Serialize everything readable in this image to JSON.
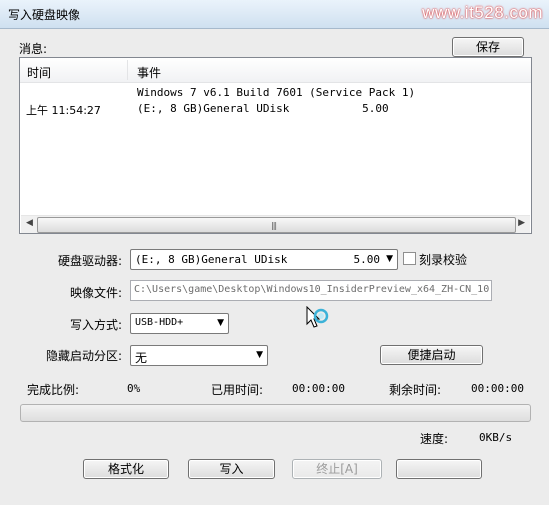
{
  "window": {
    "title": "写入硬盘映像",
    "watermark": "www.it528.com"
  },
  "messages": {
    "label": "消息:",
    "save_button": "保存",
    "columns": [
      "时间",
      "事件"
    ],
    "rows": [
      {
        "time": "",
        "event": "Windows 7 v6.1 Build 7601 (Service Pack 1)"
      },
      {
        "time": "上午 11:54:27",
        "event": "(E:, 8 GB)General UDisk           5.00"
      }
    ]
  },
  "form": {
    "drive_label": "硬盘驱动器:",
    "drive_value": "(E:, 8 GB)General UDisk          5.00",
    "verify_label": "刻录校验",
    "image_label": "映像文件:",
    "image_value": "C:\\Users\\game\\Desktop\\Windows10_InsiderPreview_x64_ZH-CN_10",
    "write_mode_label": "写入方式:",
    "write_mode_value": "USB-HDD+",
    "hidden_partition_label": "隐藏启动分区:",
    "hidden_partition_value": "无",
    "quick_boot_button": "便捷启动"
  },
  "status": {
    "complete_label": "完成比例:",
    "complete_value": "0%",
    "elapsed_label": "已用时间:",
    "elapsed_value": "00:00:00",
    "remaining_label": "剩余时间:",
    "remaining_value": "00:00:00",
    "speed_label": "速度:",
    "speed_value": "0KB/s",
    "progress": 0
  },
  "buttons": {
    "format": "格式化",
    "write": "写入",
    "abort": "终止[A]",
    "back": ""
  }
}
